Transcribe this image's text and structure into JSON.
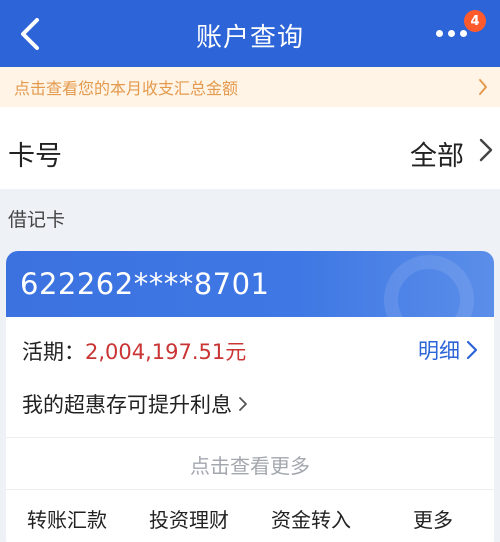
{
  "header": {
    "title": "账户查询",
    "back_icon": "chevron-left-icon",
    "more_icon": "more-dots-icon",
    "badge_count": "4"
  },
  "notice": {
    "text": "点击查看您的本月收支汇总金额"
  },
  "card_filter": {
    "label": "卡号",
    "value": "全部"
  },
  "section": {
    "label": "借记卡"
  },
  "account": {
    "number": "622262****8701",
    "balance_label": "活期：",
    "balance_amount": "2,004,197.51元",
    "detail_label": "明细",
    "promo_text": "我的超惠存可提升利息",
    "view_more": "点击查看更多",
    "actions": [
      "转账汇款",
      "投资理财",
      "资金转入",
      "更多"
    ]
  },
  "colors": {
    "header_bg": "#2d64d8",
    "notice_bg": "#fff4e5",
    "notice_text": "#e49a4e",
    "amount": "#c93434",
    "link": "#2d64d8",
    "badge": "#ff5a2c"
  }
}
